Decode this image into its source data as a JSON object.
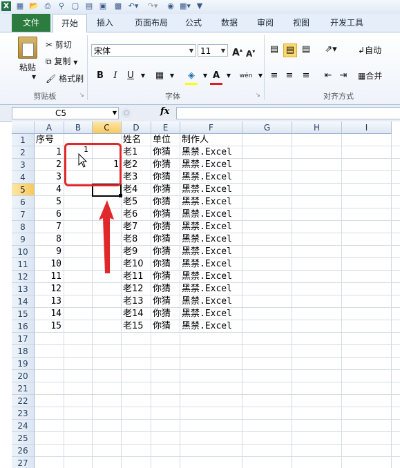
{
  "quick_access": {
    "icons": [
      "excel-logo-icon",
      "save-icon",
      "open-icon",
      "print-icon",
      "print-preview-icon",
      "new-icon",
      "undo-icon",
      "redo-icon",
      "camera-icon",
      "customize-icon"
    ]
  },
  "tabs": [
    "文件",
    "开始",
    "插入",
    "页面布局",
    "公式",
    "数据",
    "审阅",
    "视图",
    "开发工具"
  ],
  "ribbon": {
    "clipboard": {
      "paste": "粘贴",
      "cut": "剪切",
      "copy": "复制",
      "format_painter": "格式刷",
      "group": "剪贴板"
    },
    "font": {
      "name": "宋体",
      "size": "11",
      "group": "字体",
      "grow": "A",
      "shrink": "A",
      "bold": "B",
      "italic": "I",
      "underline": "U",
      "font_color_letter": "A",
      "phonetic": "wén"
    },
    "alignment": {
      "wrap": "自动",
      "merge": "合并",
      "group": "对齐方式"
    }
  },
  "formula_bar": {
    "name_box": "C5",
    "fx": "fx",
    "formula": ""
  },
  "grid": {
    "columns": [
      "A",
      "B",
      "C",
      "D",
      "E",
      "F",
      "G",
      "H",
      "I"
    ],
    "selected_col": "C",
    "selected_row": "5",
    "rows": [
      "1",
      "2",
      "3",
      "4",
      "5",
      "6",
      "7",
      "8",
      "9",
      "10",
      "11",
      "12",
      "13",
      "14",
      "15",
      "16",
      "17",
      "18",
      "19",
      "20",
      "21",
      "22",
      "23",
      "24",
      "25",
      "26",
      "27"
    ],
    "header_row": {
      "A": "序号",
      "D": "姓名",
      "E": "单位",
      "F": "制作人"
    },
    "data": [
      {
        "A": "1",
        "D": "老1",
        "E": "你猜",
        "F": "黑禁.Excel"
      },
      {
        "A": "2",
        "D": "老2",
        "E": "你猜",
        "F": "黑禁.Excel"
      },
      {
        "A": "3",
        "D": "老3",
        "E": "你猜",
        "F": "黑禁.Excel"
      },
      {
        "A": "4",
        "D": "老4",
        "E": "你猜",
        "F": "黑禁.Excel"
      },
      {
        "A": "5",
        "D": "老5",
        "E": "你猜",
        "F": "黑禁.Excel"
      },
      {
        "A": "6",
        "D": "老6",
        "E": "你猜",
        "F": "黑禁.Excel"
      },
      {
        "A": "7",
        "D": "老7",
        "E": "你猜",
        "F": "黑禁.Excel"
      },
      {
        "A": "8",
        "D": "老8",
        "E": "你猜",
        "F": "黑禁.Excel"
      },
      {
        "A": "9",
        "D": "老9",
        "E": "你猜",
        "F": "黑禁.Excel"
      },
      {
        "A": "10",
        "D": "老10",
        "E": "你猜",
        "F": "黑禁.Excel"
      },
      {
        "A": "11",
        "D": "老11",
        "E": "你猜",
        "F": "黑禁.Excel"
      },
      {
        "A": "12",
        "D": "老12",
        "E": "你猜",
        "F": "黑禁.Excel"
      },
      {
        "A": "13",
        "D": "老13",
        "E": "你猜",
        "F": "黑禁.Excel"
      },
      {
        "A": "14",
        "D": "老14",
        "E": "你猜",
        "F": "黑禁.Excel"
      },
      {
        "A": "15",
        "D": "老15",
        "E": "你猜",
        "F": "黑禁.Excel"
      }
    ],
    "b2_value": "1",
    "c3_value": "1"
  },
  "annotation_color": "#e0282a"
}
